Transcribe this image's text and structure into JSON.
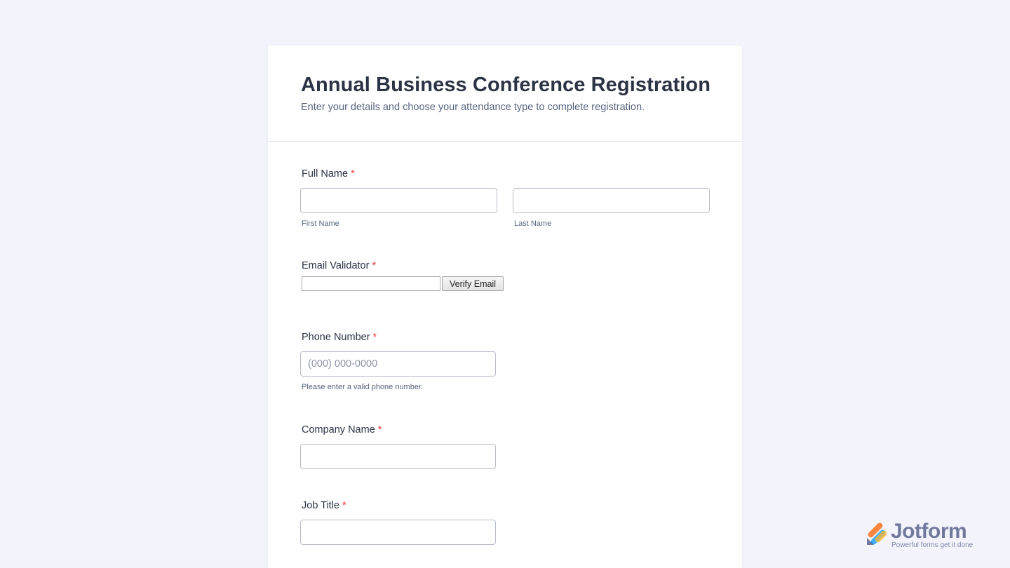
{
  "form": {
    "title": "Annual Business Conference Registration",
    "subtitle": "Enter your details and choose your attendance type to complete registration."
  },
  "fields": {
    "full_name": {
      "label": "Full Name",
      "required_mark": "*",
      "first": {
        "value": "",
        "sublabel": "First Name"
      },
      "last": {
        "value": "",
        "sublabel": "Last Name"
      }
    },
    "email_validator": {
      "label": "Email Validator",
      "required_mark": "*",
      "value": "",
      "button_label": "Verify Email"
    },
    "phone": {
      "label": "Phone Number",
      "required_mark": "*",
      "value": "",
      "placeholder": "(000) 000-0000",
      "sublabel": "Please enter a valid phone number."
    },
    "company": {
      "label": "Company Name",
      "required_mark": "*",
      "value": ""
    },
    "job_title": {
      "label": "Job Title",
      "required_mark": "*",
      "value": ""
    }
  },
  "branding": {
    "name": "Jotform",
    "tagline": "Powerful forms get it done",
    "logo_icon": "jotform-logo-icon"
  },
  "colors": {
    "page_background": "#f2f3fb",
    "card_background": "#ffffff",
    "required": "#f23a3c",
    "text": "#2c3345",
    "subtext": "#57647e"
  }
}
